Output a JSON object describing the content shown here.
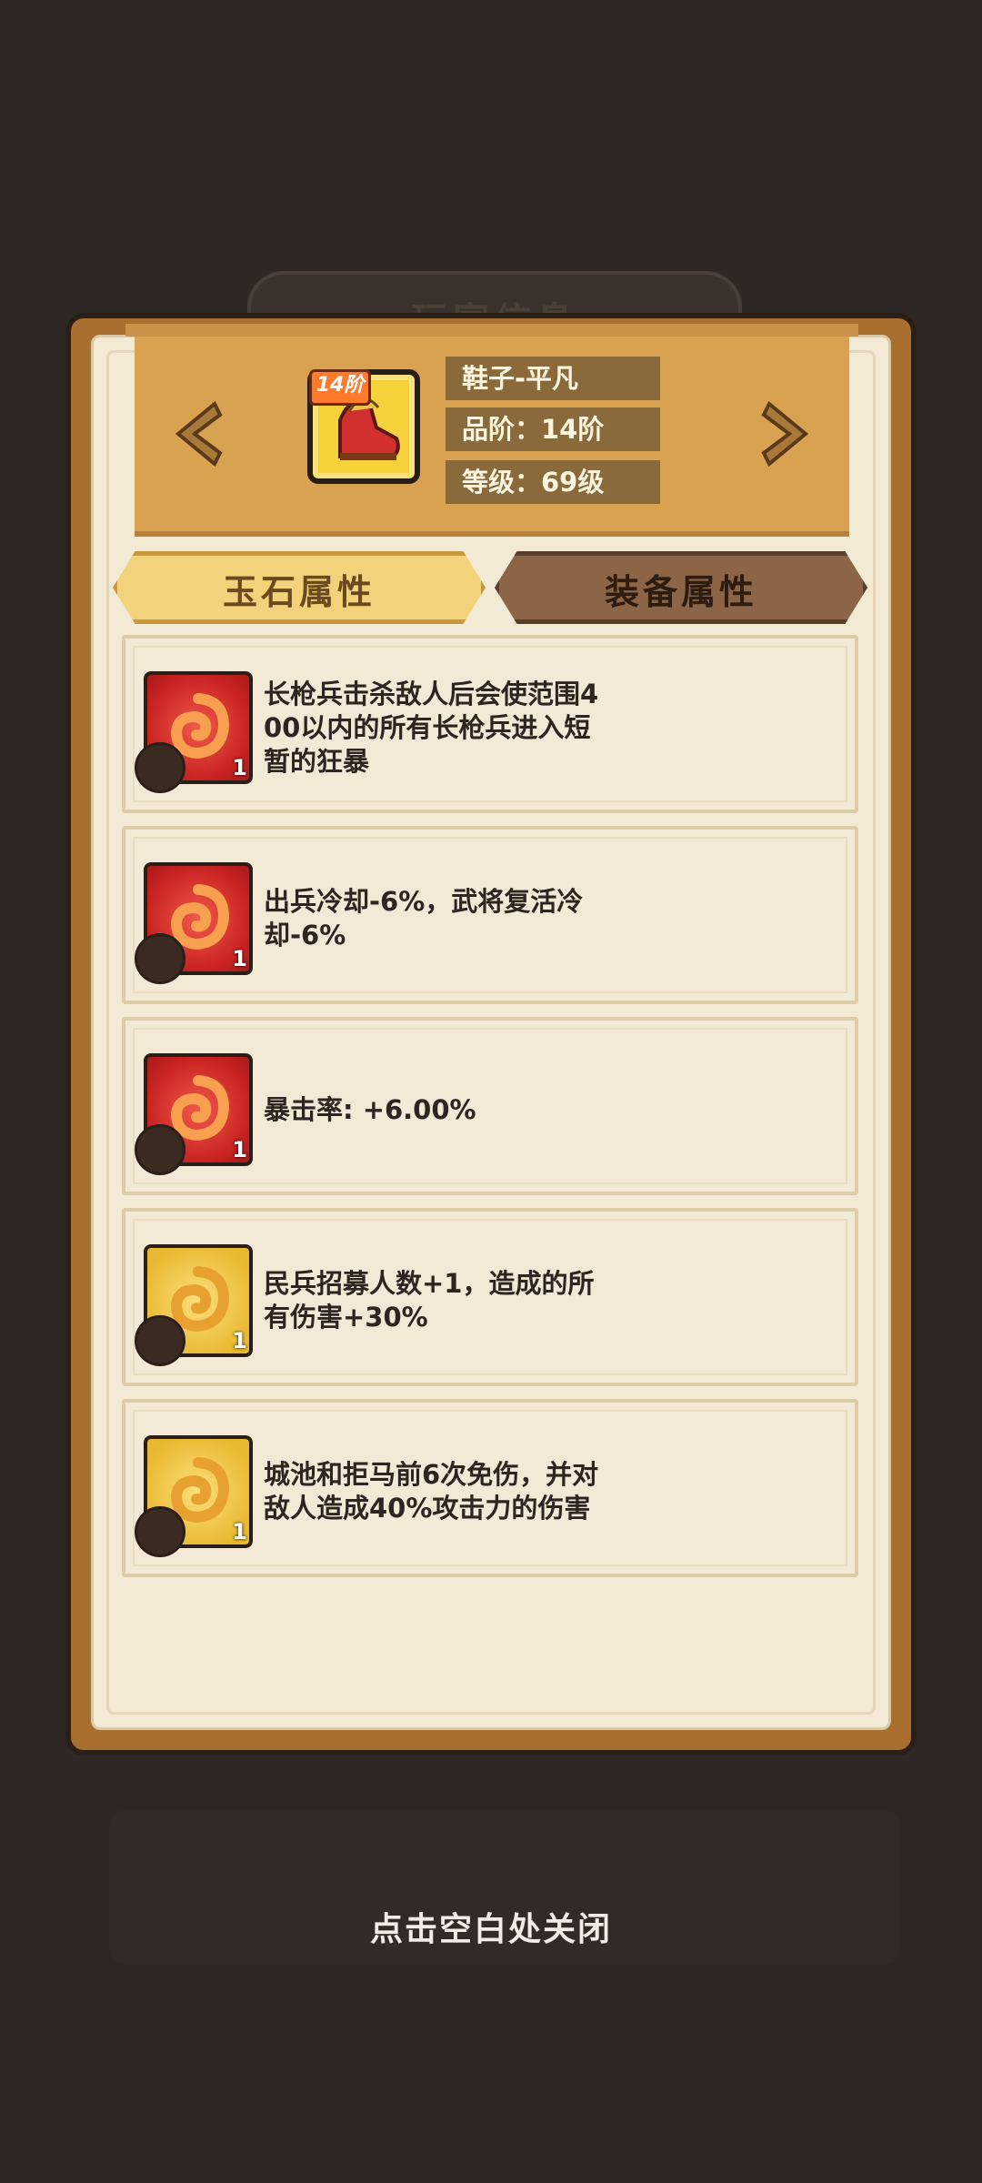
{
  "background_title": "玩家信息",
  "equipment": {
    "tier_badge": "14阶",
    "name": "鞋子-平凡",
    "grade": "品阶：14阶",
    "level": "等级：69级"
  },
  "tabs": {
    "jade": "玉石属性",
    "equip": "装备属性",
    "active": "jade"
  },
  "jade_list": [
    {
      "color": "red",
      "level": "1",
      "text_lines": [
        "长枪兵击杀敌人后会使范围4",
        "00以内的所有长枪兵进入短",
        "暂的狂暴"
      ]
    },
    {
      "color": "red",
      "level": "1",
      "text_lines": [
        "出兵冷却-6%，武将复活冷",
        "却-6%"
      ]
    },
    {
      "color": "red",
      "level": "1",
      "text_lines": [
        "暴击率: +6.00%"
      ]
    },
    {
      "color": "gold",
      "level": "1",
      "text_lines": [
        "民兵招募人数+1，造成的所",
        "有伤害+30%"
      ]
    },
    {
      "color": "gold",
      "level": "1",
      "text_lines": [
        "城池和拒马前6次免伤，并对",
        "敌人造成40%攻击力的伤害"
      ]
    }
  ],
  "close_hint": "点击空白处关闭",
  "colors": {
    "background": "#2e2724",
    "panel": "#a96f2f",
    "paper": "#f3ead6"
  }
}
